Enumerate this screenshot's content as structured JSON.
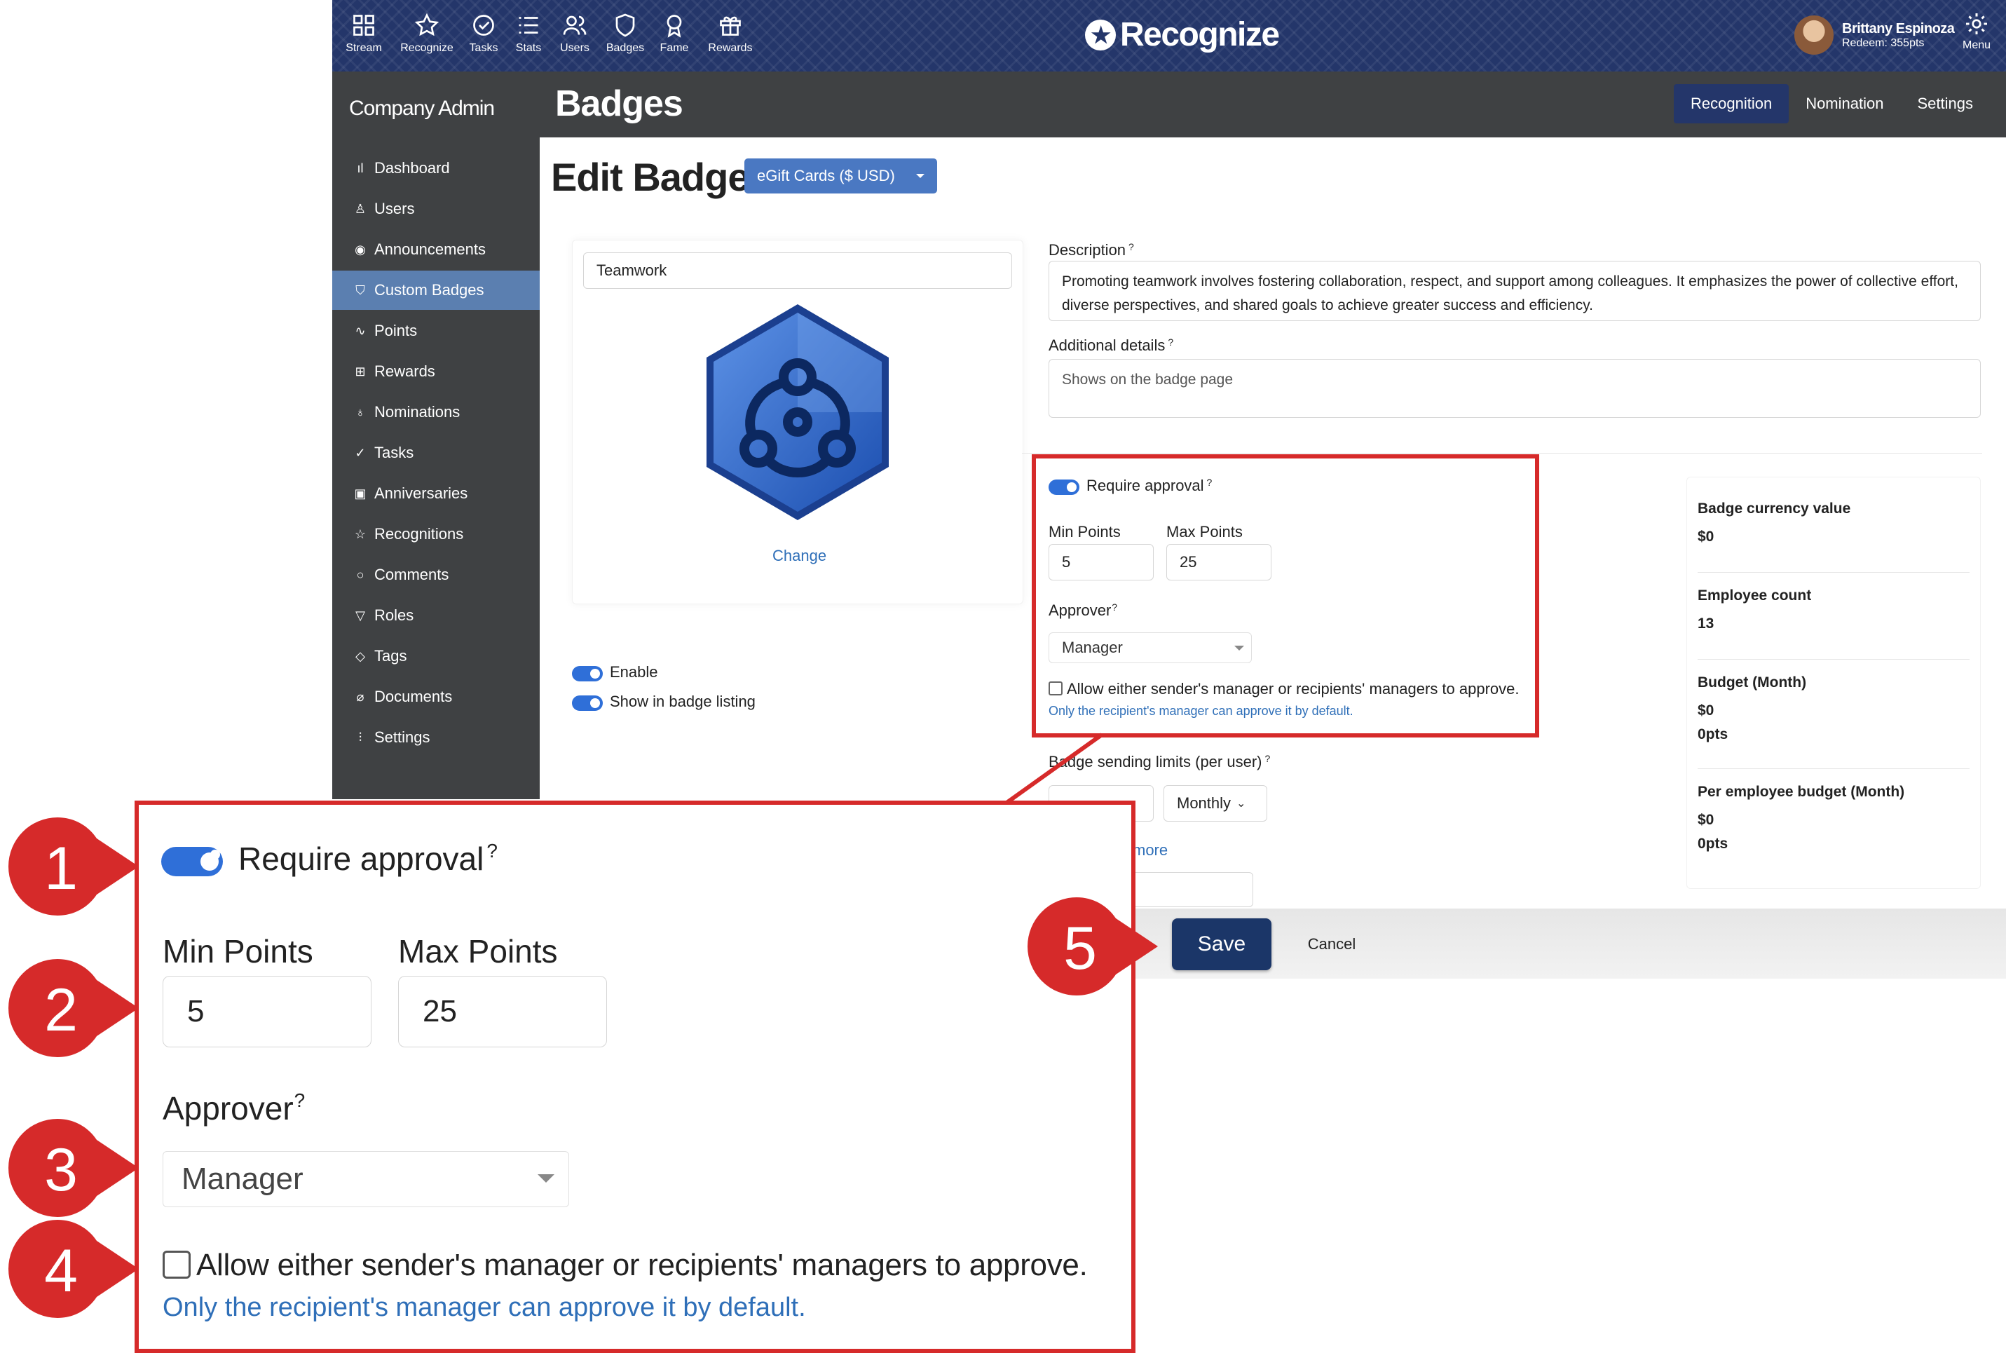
{
  "nav": {
    "items": [
      {
        "label": "Stream",
        "icon": "grid-icon"
      },
      {
        "label": "Recognize",
        "icon": "star-icon"
      },
      {
        "label": "Tasks",
        "icon": "check-circle-icon"
      },
      {
        "label": "Stats",
        "icon": "list-icon"
      },
      {
        "label": "Users",
        "icon": "users-icon"
      },
      {
        "label": "Badges",
        "icon": "shield-icon"
      },
      {
        "label": "Fame",
        "icon": "award-icon"
      },
      {
        "label": "Rewards",
        "icon": "gift-icon"
      }
    ],
    "logo": "Recognize",
    "user_name": "Brittany Espinoza",
    "user_redeem": "Redeem: 355pts",
    "menu_label": "Menu"
  },
  "header": {
    "sidebar_title": "Company Admin",
    "page_title": "Badges",
    "tabs": [
      "Recognition",
      "Nomination",
      "Settings"
    ],
    "active_tab": "Recognition"
  },
  "sidebar": {
    "items": [
      {
        "label": "Dashboard",
        "icon": "bar-chart-icon"
      },
      {
        "label": "Users",
        "icon": "user-icon"
      },
      {
        "label": "Announcements",
        "icon": "broadcast-icon"
      },
      {
        "label": "Custom Badges",
        "icon": "shield-icon"
      },
      {
        "label": "Points",
        "icon": "pulse-icon"
      },
      {
        "label": "Rewards",
        "icon": "gift-icon"
      },
      {
        "label": "Nominations",
        "icon": "award-icon"
      },
      {
        "label": "Tasks",
        "icon": "check-circle-icon"
      },
      {
        "label": "Anniversaries",
        "icon": "calendar-icon"
      },
      {
        "label": "Recognitions",
        "icon": "star-icon"
      },
      {
        "label": "Comments",
        "icon": "comment-icon"
      },
      {
        "label": "Roles",
        "icon": "filter-icon"
      },
      {
        "label": "Tags",
        "icon": "tag-icon"
      },
      {
        "label": "Documents",
        "icon": "paperclip-icon"
      },
      {
        "label": "Settings",
        "icon": "sliders-icon"
      }
    ],
    "active": "Custom Badges"
  },
  "edit": {
    "title": "Edit Badge",
    "currency_dropdown": "eGift Cards ($ USD)",
    "badge_name": "Teamwork",
    "change_link": "Change",
    "enable_label": "Enable",
    "show_listing_label": "Show in badge listing",
    "description_label": "Description",
    "description": "Promoting teamwork involves fostering collaboration, respect, and support among colleagues. It emphasizes the power of collective effort, diverse perspectives, and shared goals to achieve greater success and efficiency.",
    "additional_label": "Additional details",
    "additional_placeholder": "Shows on the badge page",
    "require_approval": "Require approval",
    "min_points_label": "Min Points",
    "min_points": "5",
    "max_points_label": "Max Points",
    "max_points": "25",
    "approver_label": "Approver",
    "approver_value": "Manager",
    "allow_either": "Allow either sender's manager or recipients' managers to approve.",
    "default_note": "Only the recipient's manager can approve it by default.",
    "sending_limits_label": "Badge sending limits (per user)",
    "sending_period": "Monthly",
    "more_link": "more",
    "save": "Save",
    "cancel": "Cancel",
    "help_mark": "?"
  },
  "stats": [
    {
      "label": "Badge currency value",
      "lines": [
        "$0"
      ]
    },
    {
      "label": "Employee count",
      "lines": [
        "13"
      ]
    },
    {
      "label": "Budget (Month)",
      "lines": [
        "$0",
        "0pts"
      ]
    },
    {
      "label": "Per employee budget (Month)",
      "lines": [
        "$0",
        "0pts"
      ]
    }
  ],
  "callouts": [
    "1",
    "2",
    "3",
    "4",
    "5"
  ],
  "colors": {
    "nav": "#24366a",
    "dark": "#3f4143",
    "accent": "#2f6fd8",
    "callout": "#d62a2a",
    "link": "#2f6fb8"
  }
}
